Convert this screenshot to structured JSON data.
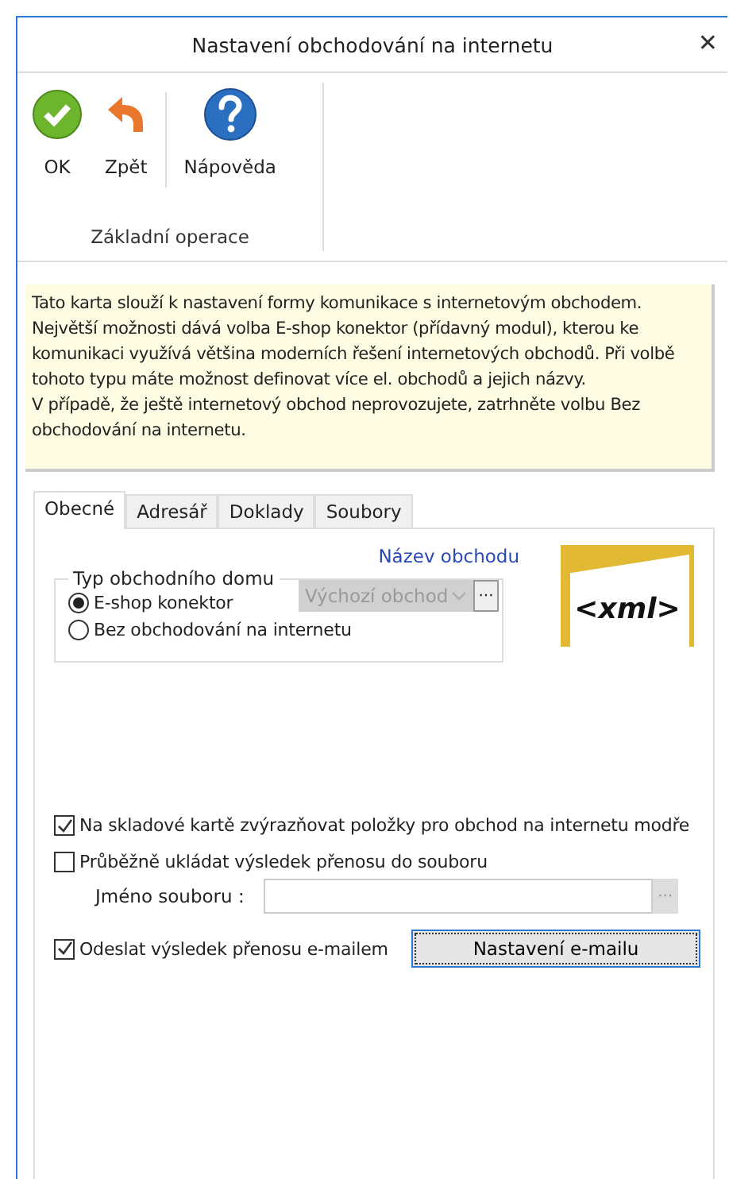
{
  "window": {
    "title": "Nastavení obchodování na internetu",
    "close": "✕"
  },
  "ribbon": {
    "buttons": [
      {
        "kind": "ok",
        "label": "OK"
      },
      {
        "kind": "back",
        "label": "Zpět"
      },
      {
        "kind": "help",
        "label": "Nápověda"
      }
    ],
    "group_label": "Základní operace"
  },
  "info": "Tato karta slouží k nastavení formy komunikace s internetovým obchodem. Největší možnosti dává volba E-shop konektor (přídavný modul), kterou ke komunikaci využívá většina moderních řešení internetových obchodů. Při volbě tohoto typu máte možnost definovat více el. obchodů a jejich názvy.\nV případě, že ještě internetový obchod neprovozujete, zatrhněte volbu Bez obchodování na internetu.",
  "tabs": [
    {
      "label": "Obecné",
      "selected": true
    },
    {
      "label": "Adresář",
      "selected": false
    },
    {
      "label": "Doklady",
      "selected": false
    },
    {
      "label": "Soubory",
      "selected": false
    }
  ],
  "shop_name_link": "Název obchodu",
  "shop_type": {
    "legend": "Typ obchodního domu",
    "options": [
      {
        "label": "E-shop konektor",
        "selected": true
      },
      {
        "label": "Bez obchodování na internetu",
        "selected": false
      }
    ],
    "combo": {
      "value": "Výchozí obchod",
      "disabled": true
    },
    "combo_button": "···"
  },
  "logo_text": "<xml>",
  "options": [
    {
      "label": "Na skladové kartě zvýrazňovat položky pro obchod na internetu modře",
      "checked": true
    },
    {
      "label": "Průběžně ukládat výsledek přenosu do souboru",
      "checked": false
    }
  ],
  "file_name": {
    "label": "Jméno souboru :",
    "browse": "···"
  },
  "email": {
    "label": "Odeslat výsledek přenosu e-mailem",
    "checked": true,
    "button": "Nastavení e-mailu"
  }
}
